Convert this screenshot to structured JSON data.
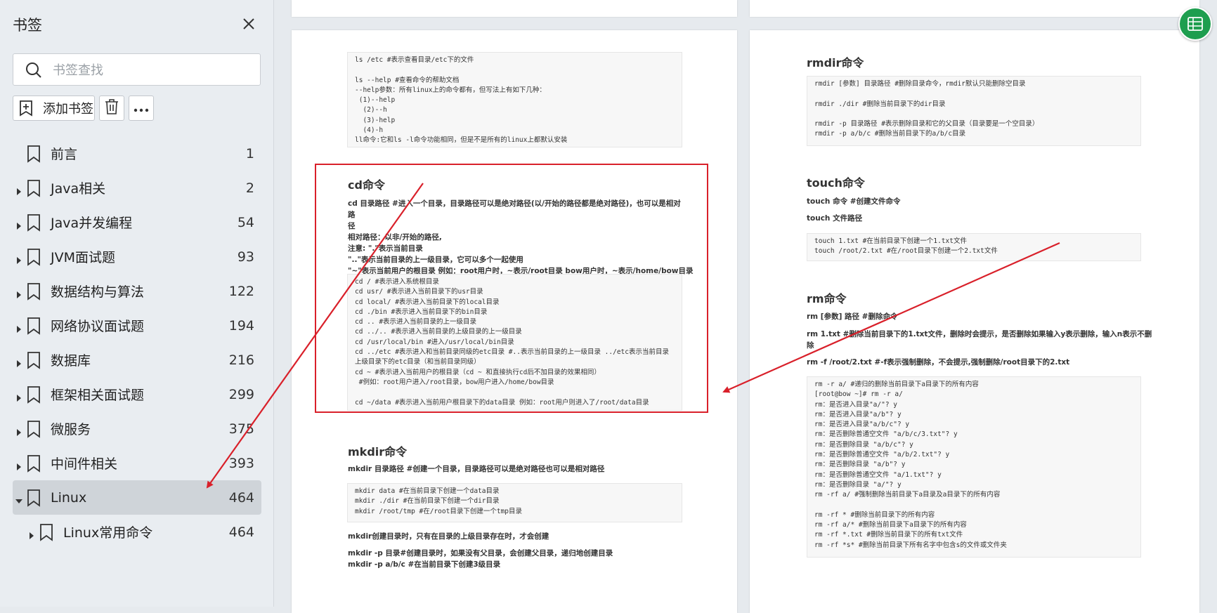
{
  "sidebar": {
    "title": "书签",
    "search_placeholder": "书签查找",
    "add_label": "添加书签",
    "items": [
      {
        "label": "前言",
        "count": "1",
        "expandable": false
      },
      {
        "label": "Java相关",
        "count": "2",
        "expandable": true
      },
      {
        "label": "Java并发编程",
        "count": "54",
        "expandable": true
      },
      {
        "label": "JVM面试题",
        "count": "93",
        "expandable": true
      },
      {
        "label": "数据结构与算法",
        "count": "122",
        "expandable": true
      },
      {
        "label": "网络协议面试题",
        "count": "194",
        "expandable": true
      },
      {
        "label": "数据库",
        "count": "216",
        "expandable": true
      },
      {
        "label": "框架相关面试题",
        "count": "299",
        "expandable": true
      },
      {
        "label": "微服务",
        "count": "375",
        "expandable": true
      },
      {
        "label": "中间件相关",
        "count": "393",
        "expandable": true
      },
      {
        "label": "Linux",
        "count": "464",
        "expandable": true,
        "expanded": true,
        "selected": true
      },
      {
        "label": "Linux常用命令",
        "count": "464",
        "expandable": true,
        "child": true
      }
    ]
  },
  "doc": {
    "left": {
      "ls_code": "ls /etc #表示查看目录/etc下的文件\n\nls --help #查看命令的帮助文档\n--help参数：所有linux上的命令都有，但写法上有如下几种：\n (1)--help\n  (2)--h\n  (3)-help\n  (4)-h\nll命令:它和ls -l命令功能相同，但是不是所有的linux上都默认安装",
      "cd_title": "cd命令",
      "cd_text": [
        "cd 目录路径 #进入一个目录，目录路径可以是绝对路径(以/开始的路径都是绝对路径)，也可以是相对路",
        "径",
        "相对路径：以非/开始的路径,",
        "注意: \".\"表示当前目录",
        "\"..\"表示当前目录的上一级目录，它可以多个一起使用",
        "\"~\"表示当前用户的根目录 例如：root用户时，~表示/root目录 bow用户时，~表示/home/bow目录"
      ],
      "cd_code": "cd / #表示进入系统根目录\ncd usr/ #表示进入当前目录下的usr目录\ncd local/ #表示进入当前目录下的local目录\ncd ./bin #表示进入当前目录下的bin目录\ncd .. #表示进入当前目录的上一级目录\ncd ../.. #表示进入当前目录的上级目录的上一级目录\ncd /usr/local/bin #进入/usr/local/bin目录\ncd ../etc #表示进入和当前目录同级的etc目录 #..表示当前目录的上一级目录 ../etc表示当前目录\n上级目录下的etc目录（和当前目录同级）\ncd ~ #表示进入当前用户的根目录（cd ~ 和直接执行cd后不加目录的效果相同）\n #例如：root用户进入/root目录，bow用户进入/home/bow目录\n\ncd ~/data #表示进入当前用户根目录下的data目录 例如：root用户则进入了/root/data目录",
      "mkdir_title": "mkdir命令",
      "mkdir_text": "mkdir 目录路径 #创建一个目录，目录路径可以是绝对路径也可以是相对路径",
      "mkdir_code": "mkdir data #在当前目录下创建一个data目录\nmkdir ./dir #在当前目录下创建一个dir目录\nmkdir /root/tmp #在/root目录下创建一个tmp目录",
      "mkdir_note": "mkdir创建目录时，只有在目录的上级目录存在时，才会创建",
      "mkdir_p1": "mkdir -p 目录#创建目录时，如果没有父目录，会创建父目录，递归地创建目录",
      "mkdir_p2": "mkdir -p a/b/c #在当前目录下创建3级目录"
    },
    "right": {
      "rmdir_title": "rmdir命令",
      "rmdir_code": "rmdir [参数] 目录路径 #删除目录命令，rmdir默认只能删除空目录\n\nrmdir ./dir #删除当前目录下的dir目录\n\nrmdir -p 目录路径 #表示删除目录和它的父目录（目录要是一个空目录）\nrmdir -p a/b/c #删除当前目录下的a/b/c目录",
      "touch_title": "touch命令",
      "touch_t1": "touch 命令 #创建文件命令",
      "touch_t2": "touch 文件路径",
      "touch_code": "touch 1.txt #在当前目录下创建一个1.txt文件\ntouch /root/2.txt #在/root目录下创建一个2.txt文件",
      "rm_title": "rm命令",
      "rm_t1": "rm [参数] 路径 #删除命令",
      "rm_t2": "rm 1.txt #删除当前目录下的1.txt文件，删除时会提示，是否删除如果输入y表示删除，输入n表示不删",
      "rm_t2b": "除",
      "rm_t3": "rm -f /root/2.txt #-f表示强制删除，不会提示,强制删除/root目录下的2.txt",
      "rm_code": "rm -r a/ #递归的删除当前目录下a目录下的所有内容\n[root@bow ~]# rm -r a/\nrm：是否进入目录\"a/\"? y\nrm：是否进入目录\"a/b\"? y\nrm：是否进入目录\"a/b/c\"? y\nrm：是否删除普通空文件 \"a/b/c/3.txt\"? y\nrm：是否删除目录 \"a/b/c\"? y\nrm：是否删除普通空文件 \"a/b/2.txt\"? y\nrm：是否删除目录 \"a/b\"? y\nrm：是否删除普通空文件 \"a/1.txt\"? y\nrm：是否删除目录 \"a/\"? y\nrm -rf a/ #强制删除当前目录下a目录及a目录下的所有内容\n\nrm -rf * #删除当前目录下的所有内容\nrm -rf a/* #删除当前目录下a目录下的所有内容\nrm -rf *.txt #删除当前目录下的所有txt文件\nrm -rf *s* #删除当前目录下所有名字中包含s的文件或文件夹"
    }
  },
  "colors": {
    "annotation": "#d9202a",
    "fab": "#1e9e4f"
  },
  "icons": [
    "close-icon",
    "search-icon",
    "add-bookmark-icon",
    "trash-icon",
    "more-icon",
    "bookmark-icon",
    "table-icon"
  ]
}
